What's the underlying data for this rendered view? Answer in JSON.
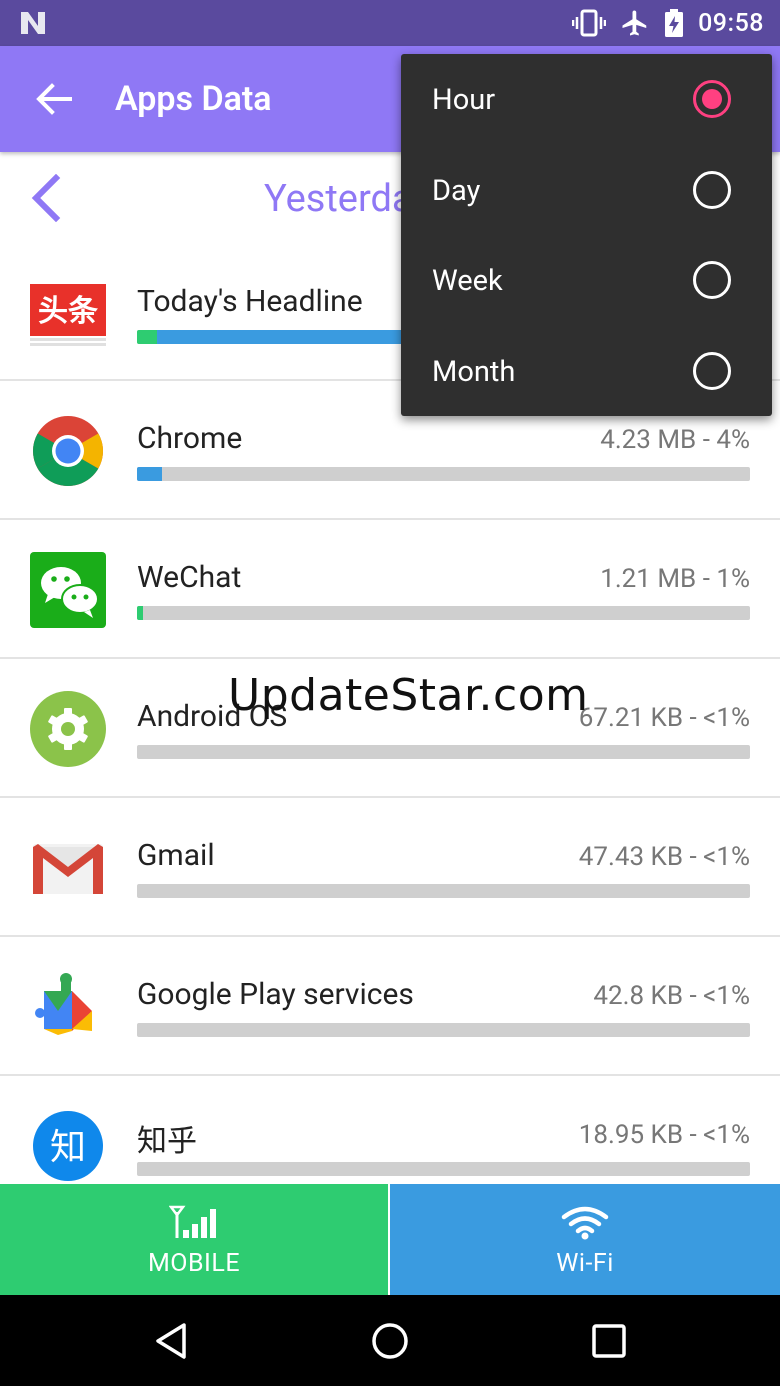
{
  "status_bar": {
    "time": "09:58"
  },
  "app_bar": {
    "title": "Apps Data"
  },
  "period": {
    "label": "Yesterday"
  },
  "apps": [
    {
      "name": "Today's Headline",
      "usage": "",
      "percent": 45,
      "icon_label": "头条",
      "icon": "toutiao-icon"
    },
    {
      "name": "Chrome",
      "usage": "4.23 MB - 4%",
      "percent": 4,
      "icon": "chrome-icon"
    },
    {
      "name": "WeChat",
      "usage": "1.21 MB - 1%",
      "percent": 1,
      "icon": "wechat-icon"
    },
    {
      "name": "Android OS",
      "usage": "67.21 KB - <1%",
      "percent": 0,
      "icon": "android-os-icon"
    },
    {
      "name": "Gmail",
      "usage": "47.43 KB - <1%",
      "percent": 0,
      "icon": "gmail-icon"
    },
    {
      "name": "Google Play services",
      "usage": "42.8 KB - <1%",
      "percent": 0,
      "icon": "google-play-services-icon"
    },
    {
      "name": "知乎",
      "usage": "18.95 KB - <1%",
      "percent": 0,
      "icon_label": "知",
      "icon": "zhihu-icon"
    }
  ],
  "watermark": "UpdateStar.com",
  "tabs": {
    "mobile": "MOBILE",
    "wifi": "Wi-Fi"
  },
  "menu": {
    "selected": "Hour",
    "items": [
      "Hour",
      "Day",
      "Week",
      "Month"
    ]
  },
  "colors": {
    "status_bar": "#5a4a9e",
    "app_bar": "#8f78f5",
    "accent": "#ff4081",
    "mobile_tab": "#2ecc71",
    "wifi_tab": "#3a9be0",
    "bar_fill": "#3a9be0",
    "bar_track": "#cfcfcf"
  }
}
